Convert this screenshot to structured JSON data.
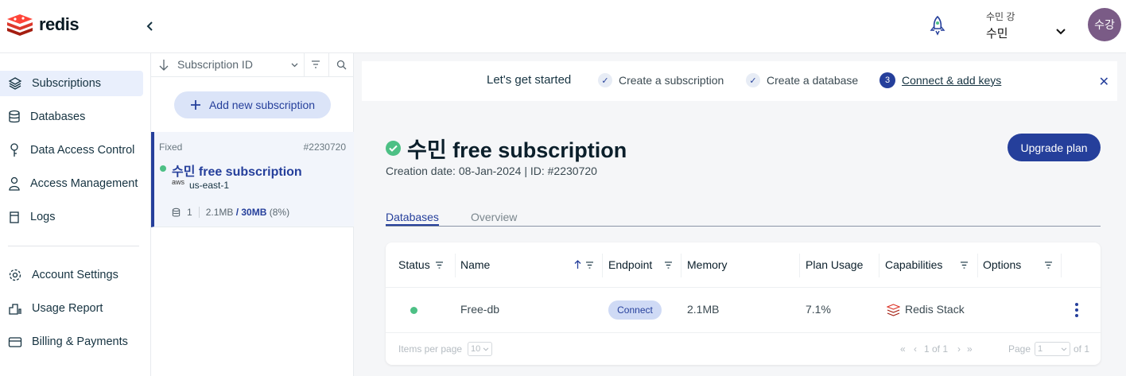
{
  "topbar": {
    "logo_text": "redis",
    "user_small": "수민 강",
    "user_name": "수민",
    "avatar_initials": "수강"
  },
  "sidebar": {
    "items": [
      {
        "label": "Subscriptions",
        "icon": "layers-icon",
        "active": true
      },
      {
        "label": "Databases",
        "icon": "database-icon"
      },
      {
        "label": "Data Access Control",
        "icon": "key-icon"
      },
      {
        "label": "Access Management",
        "icon": "user-icon"
      },
      {
        "label": "Logs",
        "icon": "logs-icon"
      },
      {
        "label": "Account Settings",
        "icon": "gear-icon"
      },
      {
        "label": "Usage Report",
        "icon": "report-icon"
      },
      {
        "label": "Billing & Payments",
        "icon": "card-icon"
      }
    ]
  },
  "sublist": {
    "sort_label": "Subscription ID",
    "add_label": "Add new subscription",
    "card": {
      "type": "Fixed",
      "id": "#2230720",
      "name": "수민 free subscription",
      "provider": "aws",
      "region": "us-east-1",
      "db_count": "1",
      "usage": "2.1MB",
      "limit": "/ 30MB",
      "percent": "(8%)"
    }
  },
  "banner": {
    "title": "Let's get started",
    "step1": "Create a subscription",
    "step2": "Create a database",
    "step3_num": "3",
    "step3": "Connect & add keys"
  },
  "main": {
    "title": "수민 free subscription",
    "creation": "Creation date: 08-Jan-2024 | ID: #2230720",
    "upgrade_label": "Upgrade plan",
    "tabs": [
      "Databases",
      "Overview"
    ]
  },
  "table": {
    "headers": [
      "Status",
      "Name",
      "Endpoint",
      "Memory",
      "Plan Usage",
      "Capabilities",
      "Options"
    ],
    "row": {
      "name": "Free-db",
      "endpoint": "Connect",
      "memory": "2.1MB",
      "plan_usage": "7.1%",
      "capabilities": "Redis Stack"
    },
    "footer": {
      "items_per_page_label": "Items per page",
      "items_per_page": "10",
      "range": "1 of 1",
      "page_label": "Page",
      "page": "1",
      "of": "of 1"
    }
  },
  "colors": {
    "primary": "#253f9b",
    "success": "#4dc085",
    "redis_red": "#dc382c"
  }
}
